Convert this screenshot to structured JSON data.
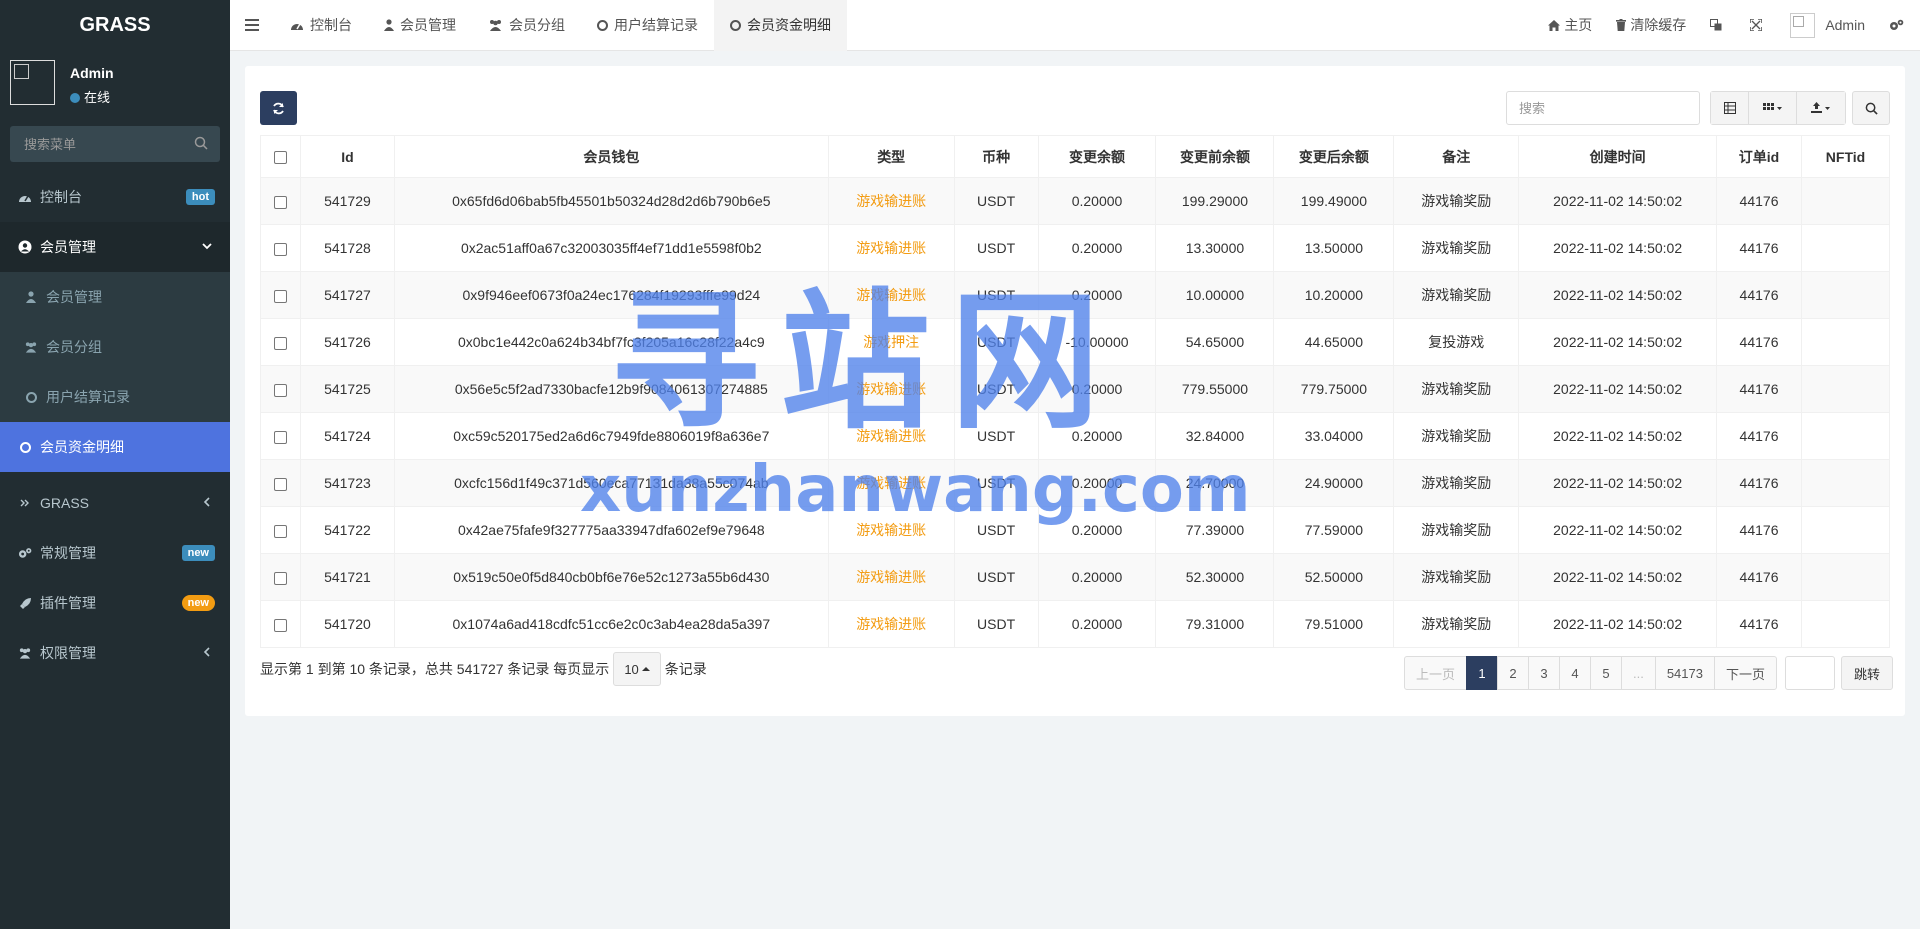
{
  "sidebar": {
    "brand": "GRASS",
    "user": {
      "name": "Admin",
      "status": "在线"
    },
    "search_placeholder": "搜索菜单",
    "menu": [
      {
        "label": "控制台",
        "badge": "hot"
      },
      {
        "label": "会员管理"
      },
      {
        "label": "会员管理"
      },
      {
        "label": "会员分组"
      },
      {
        "label": "用户结算记录"
      },
      {
        "label": "会员资金明细"
      },
      {
        "label": "GRASS"
      },
      {
        "label": "常规管理",
        "badge": "new"
      },
      {
        "label": "插件管理",
        "badge": "new"
      },
      {
        "label": "权限管理"
      }
    ]
  },
  "topbar": {
    "tabs": [
      "控制台",
      "会员管理",
      "会员分组",
      "用户结算记录",
      "会员资金明细"
    ],
    "right": {
      "home": "主页",
      "clear_cache": "清除缓存",
      "user": "Admin"
    }
  },
  "toolbar": {
    "search_placeholder": "搜索"
  },
  "table": {
    "columns": [
      "Id",
      "会员钱包",
      "类型",
      "币种",
      "变更余额",
      "变更前余额",
      "变更后余额",
      "备注",
      "创建时间",
      "订单id",
      "NFTid"
    ],
    "rows": [
      [
        "541729",
        "0x65fd6d06bab5fb45501b50324d28d2d6b790b6e5",
        "游戏输进账",
        "USDT",
        "0.20000",
        "199.29000",
        "199.49000",
        "游戏输奖励",
        "2022-11-02 14:50:02",
        "44176",
        ""
      ],
      [
        "541728",
        "0x2ac51aff0a67c32003035ff4ef71dd1e5598f0b2",
        "游戏输进账",
        "USDT",
        "0.20000",
        "13.30000",
        "13.50000",
        "游戏输奖励",
        "2022-11-02 14:50:02",
        "44176",
        ""
      ],
      [
        "541727",
        "0x9f946eef0673f0a24ec176284f19293fffe99d24",
        "游戏输进账",
        "USDT",
        "0.20000",
        "10.00000",
        "10.20000",
        "游戏输奖励",
        "2022-11-02 14:50:02",
        "44176",
        ""
      ],
      [
        "541726",
        "0x0bc1e442c0a624b34bf7fc3f205a16c28f22a4c9",
        "游戏押注",
        "USDT",
        "-10.00000",
        "54.65000",
        "44.65000",
        "复投游戏",
        "2022-11-02 14:50:02",
        "44176",
        ""
      ],
      [
        "541725",
        "0x56e5c5f2ad7330bacfe12b9f9084061307274885",
        "游戏输进账",
        "USDT",
        "0.20000",
        "779.55000",
        "779.75000",
        "游戏输奖励",
        "2022-11-02 14:50:02",
        "44176",
        ""
      ],
      [
        "541724",
        "0xc59c520175ed2a6d6c7949fde8806019f8a636e7",
        "游戏输进账",
        "USDT",
        "0.20000",
        "32.84000",
        "33.04000",
        "游戏输奖励",
        "2022-11-02 14:50:02",
        "44176",
        ""
      ],
      [
        "541723",
        "0xcfc156d1f49c371d560eca77131da38a55c074ab",
        "游戏输进账",
        "USDT",
        "0.20000",
        "24.70000",
        "24.90000",
        "游戏输奖励",
        "2022-11-02 14:50:02",
        "44176",
        ""
      ],
      [
        "541722",
        "0x42ae75fafe9f327775aa33947dfa602ef9e79648",
        "游戏输进账",
        "USDT",
        "0.20000",
        "77.39000",
        "77.59000",
        "游戏输奖励",
        "2022-11-02 14:50:02",
        "44176",
        ""
      ],
      [
        "541721",
        "0x519c50e0f5d840cb0bf6e76e52c1273a55b6d430",
        "游戏输进账",
        "USDT",
        "0.20000",
        "52.30000",
        "52.50000",
        "游戏输奖励",
        "2022-11-02 14:50:02",
        "44176",
        ""
      ],
      [
        "541720",
        "0x1074a6ad418cdfc51cc6e2c0c3ab4ea28da5a397",
        "游戏输进账",
        "USDT",
        "0.20000",
        "79.31000",
        "79.51000",
        "游戏输奖励",
        "2022-11-02 14:50:02",
        "44176",
        ""
      ]
    ]
  },
  "footer": {
    "info_prefix": "显示第 1 到第 10 条记录，总共 541727 条记录 每页显示",
    "per_page": "10",
    "info_suffix": "条记录",
    "pager": [
      "上一页",
      "1",
      "2",
      "3",
      "4",
      "5",
      "...",
      "54173",
      "下一页"
    ],
    "jump": "跳转"
  },
  "watermark": {
    "big": "寻站网",
    "small": "xunzhanwang.com"
  },
  "colors": {
    "sidebar": "#222d32",
    "active": "#4e73df",
    "primary": "#2c3e60",
    "orange": "#f39c12"
  }
}
